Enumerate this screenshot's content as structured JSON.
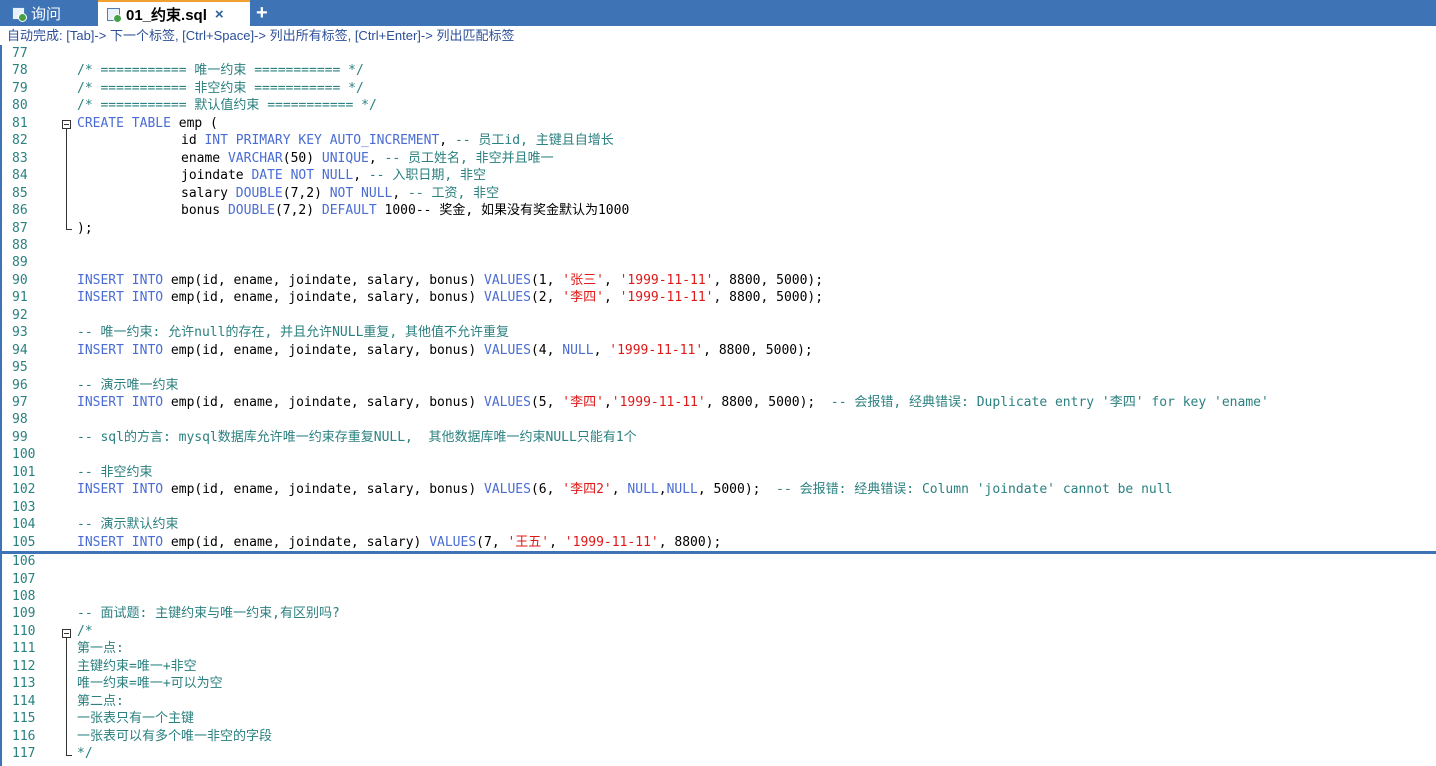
{
  "tabs": [
    {
      "label": "询问",
      "active": false,
      "icon": "query-icon"
    },
    {
      "label": "01_约束.sql",
      "active": true,
      "icon": "sql-file-icon",
      "close": "×"
    }
  ],
  "add_tab_label": "+",
  "autocomplete_hint": "自动完成: [Tab]-> 下一个标签, [Ctrl+Space]-> 列出所有标签, [Ctrl+Enter]-> 列出匹配标签",
  "lines": [
    {
      "n": "77",
      "t": []
    },
    {
      "n": "78",
      "t": [
        [
          "/* =========== 唯一约束 =========== */",
          "com"
        ]
      ]
    },
    {
      "n": "79",
      "t": [
        [
          "/* =========== 非空约束 =========== */",
          "com"
        ]
      ]
    },
    {
      "n": "80",
      "t": [
        [
          "/* =========== 默认值约束 =========== */",
          "com"
        ]
      ]
    },
    {
      "n": "81",
      "t": [
        [
          "CREATE TABLE",
          "kw"
        ],
        [
          " emp (",
          "id"
        ]
      ]
    },
    {
      "n": "82",
      "i": 1,
      "t": [
        [
          "id ",
          "id"
        ],
        [
          "INT PRIMARY KEY AUTO_INCREMENT",
          "kw"
        ],
        [
          ", ",
          "id"
        ],
        [
          "-- 员工id, 主键且自增长",
          "com"
        ]
      ]
    },
    {
      "n": "83",
      "i": 1,
      "t": [
        [
          "ename ",
          "id"
        ],
        [
          "VARCHAR",
          "kw"
        ],
        [
          "(50) ",
          "id"
        ],
        [
          "UNIQUE",
          "kw"
        ],
        [
          ", ",
          "id"
        ],
        [
          "-- 员工姓名, 非空并且唯一",
          "com"
        ]
      ]
    },
    {
      "n": "84",
      "i": 1,
      "t": [
        [
          "joindate ",
          "id"
        ],
        [
          "DATE NOT NULL",
          "kw"
        ],
        [
          ", ",
          "id"
        ],
        [
          "-- 入职日期, 非空",
          "com"
        ]
      ]
    },
    {
      "n": "85",
      "i": 1,
      "t": [
        [
          "salary ",
          "id"
        ],
        [
          "DOUBLE",
          "kw"
        ],
        [
          "(7,2) ",
          "id"
        ],
        [
          "NOT NULL",
          "kw"
        ],
        [
          ", ",
          "id"
        ],
        [
          "-- 工资, 非空",
          "com"
        ]
      ]
    },
    {
      "n": "86",
      "i": 1,
      "t": [
        [
          "bonus ",
          "id"
        ],
        [
          "DOUBLE",
          "kw"
        ],
        [
          "(7,2) ",
          "id"
        ],
        [
          "DEFAULT",
          "kw"
        ],
        [
          " 1000-- 奖金, 如果没有奖金默认为1000",
          "id"
        ]
      ]
    },
    {
      "n": "87",
      "t": [
        [
          ");",
          "id"
        ]
      ]
    },
    {
      "n": "88",
      "t": []
    },
    {
      "n": "89",
      "t": []
    },
    {
      "n": "90",
      "t": [
        [
          "INSERT INTO",
          "kw"
        ],
        [
          " emp(id, ename, joindate, salary, bonus) ",
          "id"
        ],
        [
          "VALUES",
          "kw"
        ],
        [
          "(1, ",
          "id"
        ],
        [
          "'张三'",
          "str"
        ],
        [
          ", ",
          "id"
        ],
        [
          "'1999-11-11'",
          "str"
        ],
        [
          ", 8800, 5000);",
          "id"
        ]
      ]
    },
    {
      "n": "91",
      "t": [
        [
          "INSERT INTO",
          "kw"
        ],
        [
          " emp(id, ename, joindate, salary, bonus) ",
          "id"
        ],
        [
          "VALUES",
          "kw"
        ],
        [
          "(2, ",
          "id"
        ],
        [
          "'李四'",
          "str"
        ],
        [
          ", ",
          "id"
        ],
        [
          "'1999-11-11'",
          "str"
        ],
        [
          ", 8800, 5000);",
          "id"
        ]
      ]
    },
    {
      "n": "92",
      "t": []
    },
    {
      "n": "93",
      "t": [
        [
          "-- 唯一约束: 允许null的存在, 并且允许NULL重复, 其他值不允许重复",
          "com"
        ]
      ]
    },
    {
      "n": "94",
      "t": [
        [
          "INSERT INTO",
          "kw"
        ],
        [
          " emp(id, ename, joindate, salary, bonus) ",
          "id"
        ],
        [
          "VALUES",
          "kw"
        ],
        [
          "(4, ",
          "id"
        ],
        [
          "NULL",
          "kw"
        ],
        [
          ", ",
          "id"
        ],
        [
          "'1999-11-11'",
          "str"
        ],
        [
          ", 8800, 5000);",
          "id"
        ]
      ]
    },
    {
      "n": "95",
      "t": []
    },
    {
      "n": "96",
      "t": [
        [
          "-- 演示唯一约束",
          "com"
        ]
      ]
    },
    {
      "n": "97",
      "t": [
        [
          "INSERT INTO",
          "kw"
        ],
        [
          " emp(id, ename, joindate, salary, bonus) ",
          "id"
        ],
        [
          "VALUES",
          "kw"
        ],
        [
          "(5, ",
          "id"
        ],
        [
          "'李四'",
          "str"
        ],
        [
          ",",
          "id"
        ],
        [
          "'1999-11-11'",
          "str"
        ],
        [
          ", 8800, 5000);  ",
          "id"
        ],
        [
          "-- 会报错, 经典错误: Duplicate entry '李四' for key 'ename'",
          "com"
        ]
      ]
    },
    {
      "n": "98",
      "t": []
    },
    {
      "n": "99",
      "t": [
        [
          "-- sql的方言: mysql数据库允许唯一约束存重复NULL,  其他数据库唯一约束NULL只能有1个",
          "com"
        ]
      ]
    },
    {
      "n": "100",
      "t": []
    },
    {
      "n": "101",
      "t": [
        [
          "-- 非空约束",
          "com"
        ]
      ]
    },
    {
      "n": "102",
      "t": [
        [
          "INSERT INTO",
          "kw"
        ],
        [
          " emp(id, ename, joindate, salary, bonus) ",
          "id"
        ],
        [
          "VALUES",
          "kw"
        ],
        [
          "(6, ",
          "id"
        ],
        [
          "'李四2'",
          "str"
        ],
        [
          ", ",
          "id"
        ],
        [
          "NULL",
          "kw"
        ],
        [
          ",",
          "id"
        ],
        [
          "NULL",
          "kw"
        ],
        [
          ", 5000);  ",
          "id"
        ],
        [
          "-- 会报错: 经典错误: Column 'joindate' cannot be null",
          "com"
        ]
      ]
    },
    {
      "n": "103",
      "t": []
    },
    {
      "n": "104",
      "t": [
        [
          "-- 演示默认约束",
          "com"
        ]
      ]
    },
    {
      "n": "105",
      "t": [
        [
          "INSERT INTO",
          "kw"
        ],
        [
          " emp(id, ename, joindate, salary) ",
          "id"
        ],
        [
          "VALUES",
          "kw"
        ],
        [
          "(7, ",
          "id"
        ],
        [
          "'王五'",
          "str"
        ],
        [
          ", ",
          "id"
        ],
        [
          "'1999-11-11'",
          "str"
        ],
        [
          ", 8800);",
          "id"
        ]
      ]
    },
    {
      "n": "106",
      "t": []
    },
    {
      "n": "107",
      "t": []
    },
    {
      "n": "108",
      "t": []
    },
    {
      "n": "109",
      "t": [
        [
          "-- 面试题: 主键约束与唯一约束,有区别吗?",
          "com"
        ]
      ]
    },
    {
      "n": "110",
      "t": [
        [
          "/*",
          "com"
        ]
      ]
    },
    {
      "n": "111",
      "t": [
        [
          "第一点:",
          "com"
        ]
      ]
    },
    {
      "n": "112",
      "t": [
        [
          "主键约束=唯一+非空",
          "com"
        ]
      ]
    },
    {
      "n": "113",
      "t": [
        [
          "唯一约束=唯一+可以为空",
          "com"
        ]
      ]
    },
    {
      "n": "114",
      "t": [
        [
          "第二点:",
          "com"
        ]
      ]
    },
    {
      "n": "115",
      "t": [
        [
          "一张表只有一个主键",
          "com"
        ]
      ]
    },
    {
      "n": "116",
      "t": [
        [
          "一张表可以有多个唯一非空的字段",
          "com"
        ]
      ]
    },
    {
      "n": "117",
      "t": [
        [
          "*/",
          "com"
        ]
      ]
    }
  ]
}
